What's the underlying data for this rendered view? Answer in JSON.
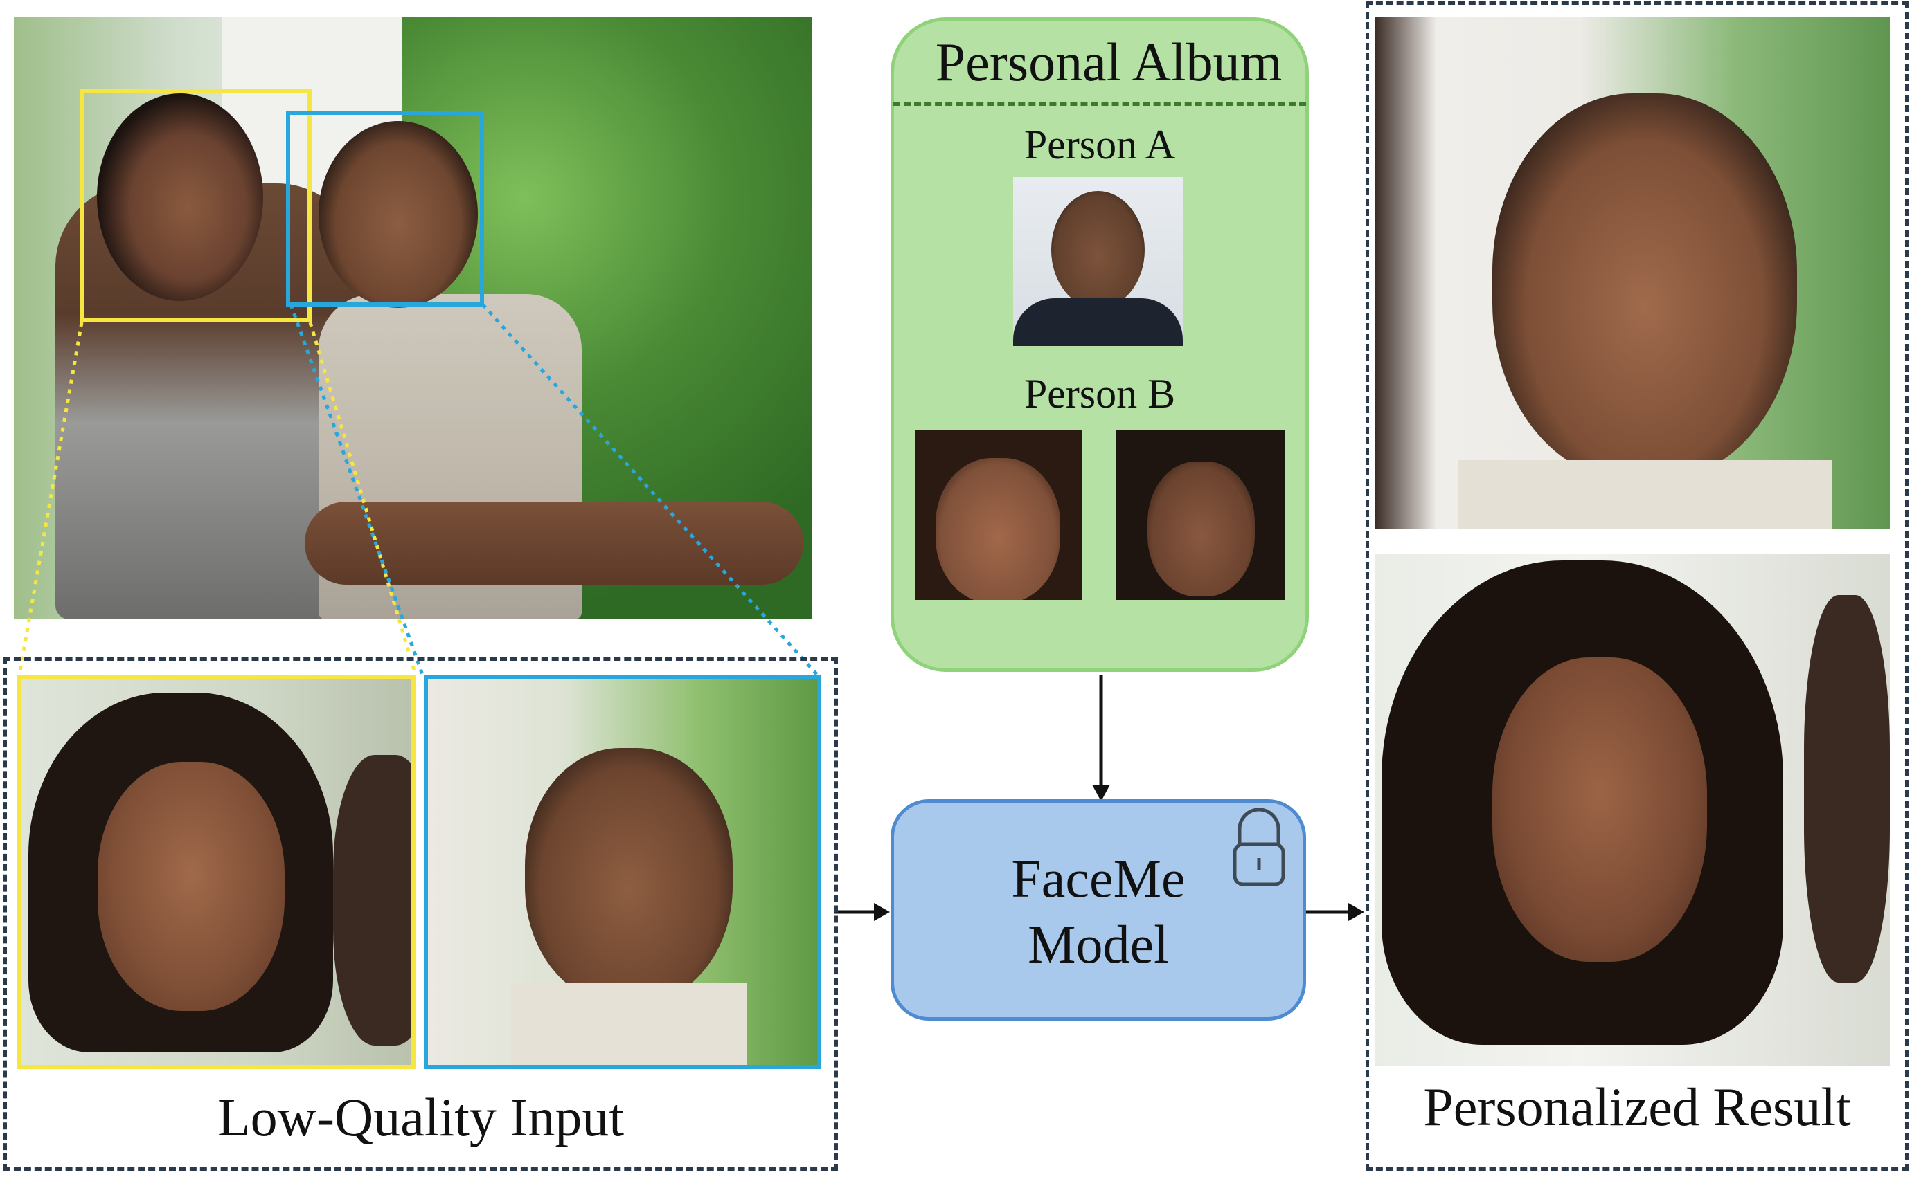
{
  "album": {
    "title": "Personal Album",
    "person_a_label": "Person A",
    "person_b_label": "Person B"
  },
  "model": {
    "line1": "FaceMe",
    "line2": "Model",
    "icon": "lock-icon"
  },
  "captions": {
    "input": "Low-Quality Input",
    "output": "Personalized Result"
  },
  "colors": {
    "album_fill": "#b5e2a4",
    "album_border": "#8fd27a",
    "album_divider": "#3d7a2e",
    "model_fill": "#a8c8ec",
    "model_border": "#4f8bd0",
    "crop_yellow": "#f5e642",
    "crop_blue": "#29a6dc",
    "dashed_border": "#2b3a4a"
  }
}
